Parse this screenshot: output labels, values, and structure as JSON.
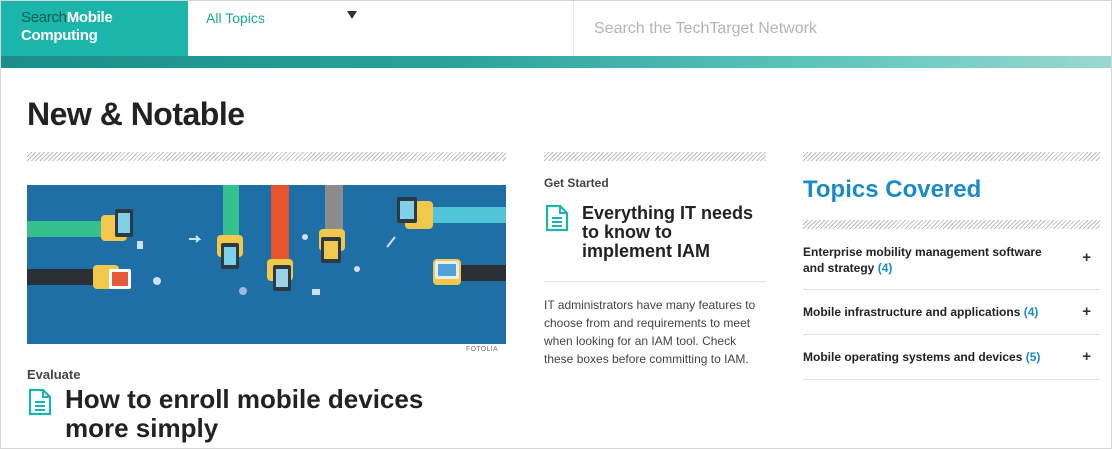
{
  "header": {
    "logo_part1": "Search",
    "logo_part2": "Mobile",
    "logo_line2": "Computing",
    "topics_label": "All Topics",
    "search_placeholder": "Search the TechTarget Network"
  },
  "main": {
    "section_title": "New & Notable",
    "hero_credit": "FOTOLIA",
    "feature": {
      "category": "Evaluate",
      "headline_line1": "How to enroll mobile devices",
      "headline_line2": "more simply"
    },
    "second": {
      "category": "Get Started",
      "headline_line1": "Everything IT needs",
      "headline_line2": "to know to",
      "headline_line3": "implement IAM",
      "desc_line1": "IT administrators have many features to",
      "desc_line2": "choose from and requirements to meet",
      "desc_line3": "when looking for an IAM tool. Check",
      "desc_line4": "these boxes before committing to IAM."
    }
  },
  "sidebar": {
    "title": "Topics Covered",
    "topics": [
      {
        "label_line1": "Enterprise mobility management software",
        "label_line2": "and strategy",
        "count": "(4)"
      },
      {
        "label": "Mobile infrastructure and applications",
        "count": "(4)"
      },
      {
        "label": "Mobile operating systems and devices",
        "count": "(5)"
      }
    ],
    "expand_symbol": "+"
  },
  "colors": {
    "brand_teal": "#1cb5aa",
    "link_blue": "#1a8bc4",
    "hero_blue": "#1e6fa6"
  }
}
